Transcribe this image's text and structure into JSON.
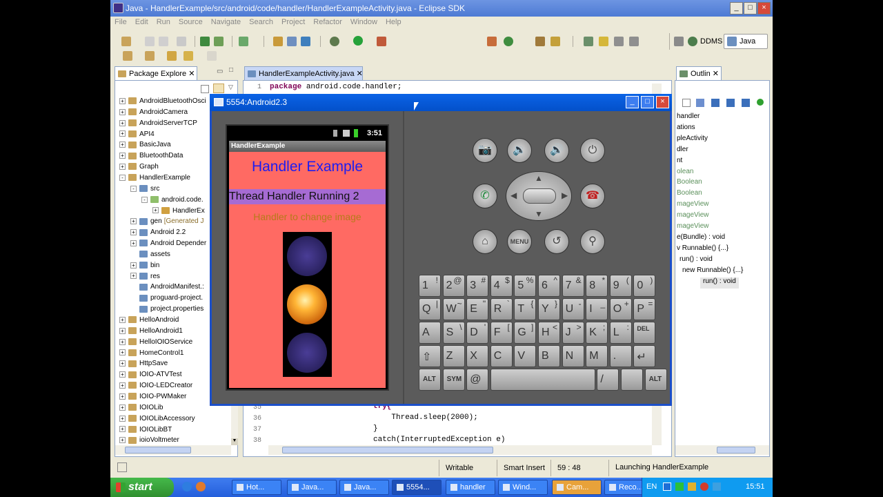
{
  "window": {
    "title": "Java - HandlerExample/src/android/code/handler/HandlerExampleActivity.java - Eclipse SDK"
  },
  "menu": [
    "File",
    "Edit",
    "Run",
    "Source",
    "Navigate",
    "Search",
    "Project",
    "Refactor",
    "Window",
    "Help"
  ],
  "perspectives": {
    "ddms": "DDMS",
    "java": "Java"
  },
  "package_explorer": {
    "title": "Package Explore",
    "items": [
      {
        "label": "AndroidBluetoothOsci",
        "depth": 0,
        "exp": "+"
      },
      {
        "label": "AndroidCamera",
        "depth": 0,
        "exp": "+"
      },
      {
        "label": "AndroidServerTCP",
        "depth": 0,
        "exp": "+"
      },
      {
        "label": "API4",
        "depth": 0,
        "exp": "+"
      },
      {
        "label": "BasicJava",
        "depth": 0,
        "exp": "+"
      },
      {
        "label": "BluetoothData",
        "depth": 0,
        "exp": "+"
      },
      {
        "label": "Graph",
        "depth": 0,
        "exp": "+"
      },
      {
        "label": "HandlerExample",
        "depth": 0,
        "exp": "-"
      },
      {
        "label": "src",
        "depth": 1,
        "exp": "-"
      },
      {
        "label": "android.code.",
        "depth": 2,
        "exp": "-"
      },
      {
        "label": "HandlerEx",
        "depth": 3,
        "exp": "+"
      },
      {
        "label": "gen",
        "extra": "[Generated J",
        "depth": 1,
        "exp": "+"
      },
      {
        "label": "Android 2.2",
        "depth": 1,
        "exp": "+"
      },
      {
        "label": "Android Depender",
        "depth": 1,
        "exp": "+"
      },
      {
        "label": "assets",
        "depth": 1,
        "exp": ""
      },
      {
        "label": "bin",
        "depth": 1,
        "exp": "+"
      },
      {
        "label": "res",
        "depth": 1,
        "exp": "+"
      },
      {
        "label": "AndroidManifest.:",
        "depth": 1,
        "exp": ""
      },
      {
        "label": "proguard-project.",
        "depth": 1,
        "exp": ""
      },
      {
        "label": "project.properties",
        "depth": 1,
        "exp": ""
      },
      {
        "label": "HelloAndroid",
        "depth": 0,
        "exp": "+"
      },
      {
        "label": "HelloAndroid1",
        "depth": 0,
        "exp": "+"
      },
      {
        "label": "HelloIOIOService",
        "depth": 0,
        "exp": "+"
      },
      {
        "label": "HomeControl1",
        "depth": 0,
        "exp": "+"
      },
      {
        "label": "HttpSave",
        "depth": 0,
        "exp": "+"
      },
      {
        "label": "IOIO-ATVTest",
        "depth": 0,
        "exp": "+"
      },
      {
        "label": "IOIO-LEDCreator",
        "depth": 0,
        "exp": "+"
      },
      {
        "label": "IOIO-PWMaker",
        "depth": 0,
        "exp": "+"
      },
      {
        "label": "IOIOLib",
        "depth": 0,
        "exp": "+"
      },
      {
        "label": "IOIOLibAccessory",
        "depth": 0,
        "exp": "+"
      },
      {
        "label": "IOIOLibBT",
        "depth": 0,
        "exp": "+"
      },
      {
        "label": "ioioVoltmeter",
        "depth": 0,
        "exp": "+"
      }
    ]
  },
  "editor": {
    "tab": "HandlerExampleActivity.java",
    "line1": {
      "num": "1",
      "kw": "package",
      "rest": " android.code.handler;"
    },
    "lines": [
      {
        "num": "35",
        "text": "try{"
      },
      {
        "num": "36",
        "text": "    Thread.sleep(2000);"
      },
      {
        "num": "37",
        "text": "}"
      },
      {
        "num": "38",
        "text": "catch(InterruptedException e)"
      }
    ]
  },
  "outline": {
    "title": "Outlin",
    "items": [
      "handler",
      "ations",
      "pleActivity",
      "dler",
      "nt",
      "olean",
      "Boolean",
      "Boolean",
      "mageView",
      "mageView",
      "mageView",
      "e(Bundle) : void",
      "v Runnable() {...}",
      "run() : void",
      "new Runnable() {...}",
      "run() : void"
    ]
  },
  "emulator": {
    "title": "5554:Android2.3",
    "status_time": "3:51",
    "app_title": "HandlerExample",
    "heading": "Handler Example",
    "thread_text": "Thread Handler Running 2",
    "sub_text": "Handler to change image",
    "keyboard": {
      "row1": [
        [
          "1",
          "!"
        ],
        [
          "2",
          "@"
        ],
        [
          "3",
          "#"
        ],
        [
          "4",
          "$"
        ],
        [
          "5",
          "%"
        ],
        [
          "6",
          "^"
        ],
        [
          "7",
          "&"
        ],
        [
          "8",
          "*"
        ],
        [
          "9",
          "("
        ],
        [
          "0",
          ")"
        ]
      ],
      "row2": [
        [
          "Q",
          "|"
        ],
        [
          "W",
          "~"
        ],
        [
          "E",
          "\""
        ],
        [
          "R",
          "`"
        ],
        [
          "T",
          "{"
        ],
        [
          "Y",
          "}"
        ],
        [
          "U",
          "-"
        ],
        [
          "I",
          "_"
        ],
        [
          "O",
          "+"
        ],
        [
          "P",
          "="
        ]
      ],
      "row3": [
        [
          "A",
          ""
        ],
        [
          "S",
          "\\"
        ],
        [
          "D",
          "'"
        ],
        [
          "F",
          "["
        ],
        [
          "G",
          "]"
        ],
        [
          "H",
          "<"
        ],
        [
          "J",
          ">"
        ],
        [
          "K",
          ";"
        ],
        [
          "L",
          ":"
        ],
        [
          "DEL",
          ""
        ]
      ],
      "row4": [
        [
          "⇧",
          ""
        ],
        [
          "Z",
          ""
        ],
        [
          "X",
          ""
        ],
        [
          "C",
          ""
        ],
        [
          "V",
          ""
        ],
        [
          "B",
          ""
        ],
        [
          "N",
          ""
        ],
        [
          "M",
          ""
        ],
        [
          ".",
          ""
        ],
        [
          "↵",
          ""
        ]
      ],
      "row5": [
        "ALT",
        "SYM",
        "@",
        "",
        "/",
        "",
        "ALT"
      ],
      "menu_label": "MENU"
    }
  },
  "status_bar": {
    "mode": "Writable",
    "insert": "Smart Insert",
    "position": "59 : 48",
    "launch": "Launching HandlerExample"
  },
  "taskbar": {
    "start": "start",
    "tasks": [
      "Hot...",
      "Java...",
      "Java...",
      "5554...",
      "handler",
      "Wind...",
      "Cam...",
      "Reco..."
    ],
    "lang": "EN",
    "clock": "15:51"
  },
  "colors": {
    "app_bg": "#ff6a63",
    "thread_bg": "#a66bd3",
    "heading": "#1d1df0",
    "sub": "#b77a1a",
    "xp_blue": "#245edb"
  }
}
